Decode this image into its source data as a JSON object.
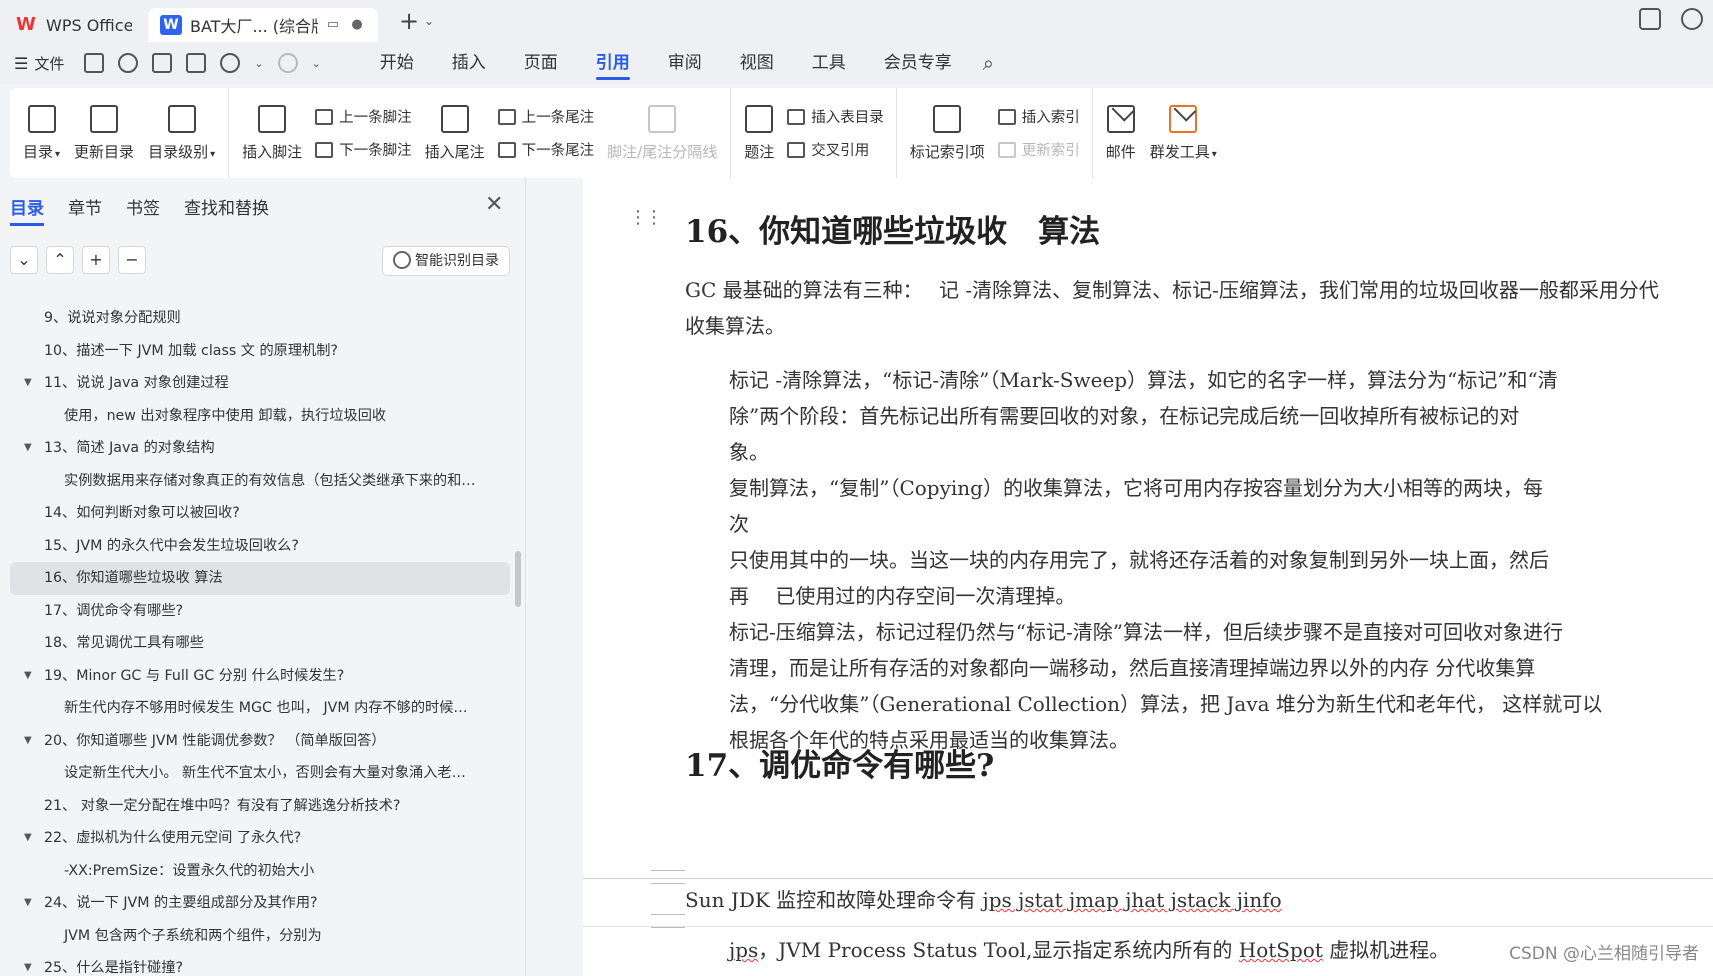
{
  "titlebar": {
    "app_tab": "WPS Office",
    "doc_tab": "BAT大厂... (综合版)"
  },
  "menubar": {
    "file": "文件",
    "menus": [
      "开始",
      "插入",
      "页面",
      "引用",
      "审阅",
      "视图",
      "工具",
      "会员专享"
    ],
    "active_menu": "引用"
  },
  "ribbon": {
    "toc": "目录",
    "update_toc": "更新目录",
    "toc_level": "目录级别",
    "insert_footnote": "插入脚注",
    "prev_footnote": "上一条脚注",
    "next_footnote": "下一条脚注",
    "insert_endnote": "插入尾注",
    "prev_endnote": "上一条尾注",
    "next_endnote": "下一条尾注",
    "separator": "脚注/尾注分隔线",
    "caption": "题注",
    "insert_figure_toc": "插入表目录",
    "cross_ref": "交叉引用",
    "mark_index": "标记索引项",
    "insert_index": "插入索引",
    "update_index": "更新索引",
    "mail": "邮件",
    "mass_tool": "群发工具"
  },
  "leftpanel": {
    "tabs": [
      "目录",
      "章节",
      "书签",
      "查找和替换"
    ],
    "smart_btn": "智能识别目录",
    "toc": [
      {
        "text": "9、说说对象分配规则",
        "level": 1,
        "tri": ""
      },
      {
        "text": "10、描述一下 JVM 加载 class 文 的原理机制?",
        "level": 1,
        "tri": ""
      },
      {
        "text": "11、说说 Java 对象创建过程",
        "level": 1,
        "tri": "▼"
      },
      {
        "text": "使用，new 出对象程序中使用 卸载，执行垃圾回收",
        "level": 2,
        "tri": ""
      },
      {
        "text": "13、简述 Java 的对象结构",
        "level": 1,
        "tri": "▼"
      },
      {
        "text": "实例数据用来存储对象真正的有效信息（包括父类继承下来的和…",
        "level": 2,
        "tri": ""
      },
      {
        "text": "14、如何判断对象可以被回收?",
        "level": 1,
        "tri": ""
      },
      {
        "text": "15、JVM 的永久代中会发生垃圾回收么?",
        "level": 1,
        "tri": ""
      },
      {
        "text": "16、你知道哪些垃圾收 算法",
        "level": 1,
        "tri": "",
        "selected": true
      },
      {
        "text": "17、调优命令有哪些?",
        "level": 1,
        "tri": ""
      },
      {
        "text": "18、常见调优工具有哪些",
        "level": 1,
        "tri": ""
      },
      {
        "text": "19、Minor GC 与 Full GC 分别 什么时候发生?",
        "level": 1,
        "tri": "▼"
      },
      {
        "text": "新生代内存不够用时候发生 MGC 也叫， JVM 内存不够的时候…",
        "level": 2,
        "tri": ""
      },
      {
        "text": "20、你知道哪些 JVM 性能调优参数？ （简单版回答）",
        "level": 1,
        "tri": "▼"
      },
      {
        "text": "设定新生代大小。 新生代不宜太小，否则会有大量对象涌入老…",
        "level": 2,
        "tri": ""
      },
      {
        "text": "21、 对象一定分配在堆中吗？有没有了解逃逸分析技术?",
        "level": 1,
        "tri": ""
      },
      {
        "text": "22、虚拟机为什么使用元空间 了永久代?",
        "level": 1,
        "tri": "▼"
      },
      {
        "text": "-XX:PremSize：设置永久代的初始大小",
        "level": 2,
        "tri": ""
      },
      {
        "text": "24、说一下 JVM 的主要组成部分及其作用?",
        "level": 1,
        "tri": "▼"
      },
      {
        "text": "JVM 包含两个子系统和两个组件，分别为",
        "level": 2,
        "tri": ""
      },
      {
        "text": "25、什么是指针碰撞?",
        "level": 1,
        "tri": "▼"
      }
    ]
  },
  "document": {
    "h16": "16、你知道哪些垃圾收　算法",
    "p0": "GC 最基础的算法有三种：　 记 -清除算法、复制算法、标记-压缩算法，我们常用的垃圾回收器一般都采用分代收集算法。",
    "p1_lines": [
      "标记 -清除算法，“标记-清除”（Mark-Sweep）算法，如它的名字一样，算法分为“标记”和“清",
      "除”两个阶段：首先标记出所有需要回收的对象，在标记完成后统一回收掉所有被标记的对",
      "象。",
      "复制算法，“复制”（Copying）的收集算法，它将可用内存按容量划分为大小相等的两块，每",
      "次",
      "只使用其中的一块。当这一块的内存用完了，就将还存活着的对象复制到另外一块上面，然后",
      "再　 已使用过的内存空间一次清理掉。",
      "标记-压缩算法，标记过程仍然与“标记-清除”算法一样，但后续步骤不是直接对可回收对象进行",
      "清理，而是让所有存活的对象都向一端移动，然后直接清理掉端边界以外的内存 分代收集算",
      "法，“分代收集”（Generational Collection）算法，把 Java 堆分为新生代和老年代， 这样就可以",
      "根据各个年代的特点采用最适当的收集算法。"
    ],
    "h17": "17、调优命令有哪些?",
    "cmd_prefix": "Sun JDK 监控和故障处理命令有 ",
    "cmd_list": "jps jstat jmap jhat jstack jinfo",
    "jps_a": "jps",
    "jps_b": "，JVM Process Status Tool,显示指定系统内所有的 ",
    "jps_c": "HotSpot",
    "jps_d": " 虚拟机进程。"
  },
  "watermark": "CSDN @心兰相随引导者"
}
